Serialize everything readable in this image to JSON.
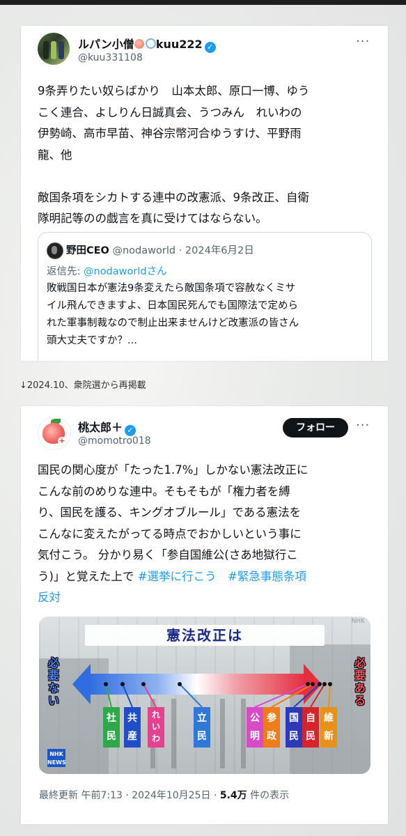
{
  "tweet1": {
    "author_name": "ルパン小僧",
    "author_name_suffix": "kuu222",
    "handle": "@kuu331108",
    "body_lines": [
      "9条弄りたい奴らばかり　山本太郎、原口一博、ゆう",
      "こく連合、よしりん日誠真会、うつみん　れいわの",
      "伊勢崎、高市早苗、神谷宗幣河合ゆうすけ、平野雨",
      "龍、他",
      "",
      "敵国条項をシカトする連中の改憲派、9条改正、自衛",
      "隊明記等のの戯言を真に受けてはならない。"
    ],
    "quote": {
      "author_name": "野田CEO",
      "handle": "@nodaworld",
      "date": "· 2024年6月2日",
      "reply_prefix": "返信先: ",
      "reply_handle": "@nodaworldさん",
      "text_lines": [
        "敗戦国日本が憲法9条変えたら敵国条項で容赦なくミサ",
        "イル飛んできますよ、日本国民死んでも国際法で定めら",
        "れた軍事制裁なので制止出来ませんけど改憲派の皆さん",
        "頭大丈夫ですか？..."
      ]
    }
  },
  "repost_note": "↓2024.10、衆院選から再掲載",
  "tweet2": {
    "author_name": "桃太郎＋",
    "handle": "@momotro018",
    "follow_label": "フォロー",
    "body_lines": [
      "国民の関心度が「たった1.7%」しかない憲法改正に",
      "こんな前のめりな連中。そもそもが「権力者を縛",
      "り、国民を護る、キングオブルール」である憲法を",
      "こんなに変えたがってる時点でおかしいという事に",
      "気付こう。 分かり易く「参自国維公(さあ地獄行こ"
    ],
    "body_line6_text": "う)」と覚えた上で ",
    "hashtag1": "#選挙に行こう",
    "hashtag2_line6": "#緊急事態条項",
    "hashtag2_line7": "反対",
    "media": {
      "title": "憲法改正は",
      "left_label": "必要ない",
      "right_label": "必要ある",
      "channel": "NHK NEWS",
      "top_right_caption": "NHK",
      "parties": [
        {
          "name": "社民",
          "color": "#2fa84a"
        },
        {
          "name": "共産",
          "color": "#1f4ec8"
        },
        {
          "name": "れいわ",
          "color": "#e6418f"
        },
        {
          "name": "立民",
          "color": "#2f78d8"
        },
        {
          "name": "公明",
          "color": "#d64bc8"
        },
        {
          "name": "参政",
          "color": "#f07c18"
        },
        {
          "name": "国民",
          "color": "#2a3ab8"
        },
        {
          "name": "自民",
          "color": "#d8232a"
        },
        {
          "name": "維新",
          "color": "#e89018"
        }
      ]
    },
    "footer_time": "最終更新 午前7:13 · 2024年10月25日 · ",
    "footer_views": "5.4万",
    "footer_views_suffix": " 件の表示"
  },
  "colors": {
    "link": "#1d9bf0",
    "text": "#0f1419",
    "muted": "#536471",
    "verified": "#1d9bf0"
  },
  "icons": [
    "verified-icon",
    "more-icon",
    "peach-icon",
    "ring-icon"
  ]
}
